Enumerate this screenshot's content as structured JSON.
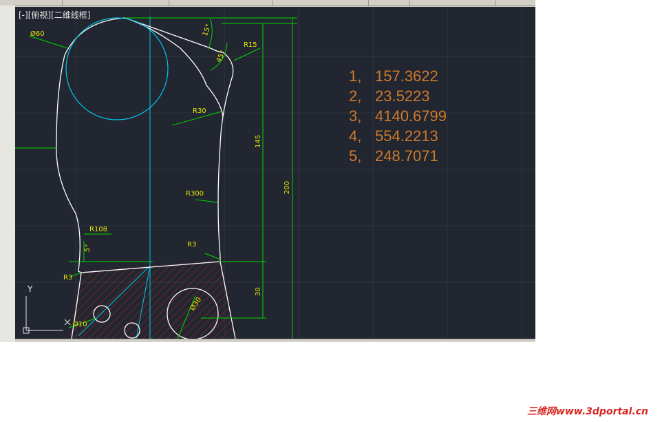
{
  "viewport": {
    "label": "[-][俯视][二维线框]"
  },
  "dimensions": {
    "d60": "Ø60",
    "r15": "R15",
    "a15": "15°",
    "a45": "45°",
    "r30": "R30",
    "d145": "145",
    "d200": "200",
    "r300": "R300",
    "r108": "R108",
    "a5": "5°",
    "r3_right": "R3",
    "r3_left": "R3",
    "d30": "30",
    "d30_circle": "Ø30",
    "d10": "Ø10"
  },
  "results": [
    {
      "index": "1,",
      "value": "157.3622"
    },
    {
      "index": "2,",
      "value": "23.5223"
    },
    {
      "index": "3,",
      "value": "4140.6799"
    },
    {
      "index": "4,",
      "value": "554.2213"
    },
    {
      "index": "5,",
      "value": "248.7071"
    }
  ],
  "ucs_axis_label": "Y",
  "watermark": "三维网www.3dportal.cn",
  "colors": {
    "background": "#222630",
    "outline": "#ffffff",
    "dimension": "#00d800",
    "dimension_text": "#e8e800",
    "centerline": "#00c8e8",
    "hatch": "#b02020",
    "results": "#d07a2a"
  }
}
